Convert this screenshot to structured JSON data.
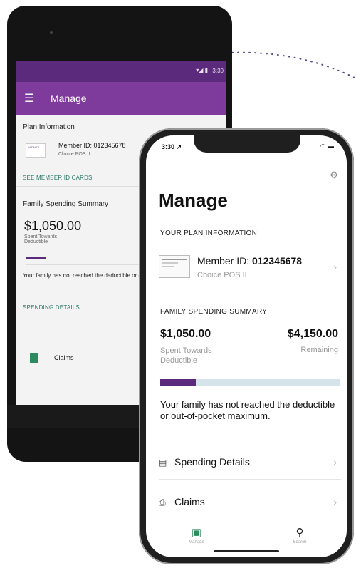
{
  "android": {
    "status_time": "3:30",
    "status_signal": "▾◢ ▮",
    "menu_icon": "hamburger-icon",
    "title": "Manage",
    "plan_section_title": "Plan Information",
    "card_brand": "WIDNEY",
    "member_id": "Member ID: 012345678",
    "plan_name": "Choice POS II",
    "see_cards_link": "SEE MEMBER ID CARDS",
    "spending_section_title": "Family Spending Summary",
    "spent_amount": "$1,050.00",
    "spent_label": "Spent Towards Deductible",
    "progress_fraction": 0.18,
    "family_note": "Your family has not reached the deductible or out-of-pocket maximum.",
    "spending_details_link": "SPENDING DETAILS",
    "claims_label": "Claims",
    "claims_icon": "document-icon"
  },
  "iphone": {
    "status_time": "3:30 ↗",
    "status_icons": "◠ ▬",
    "title": "Manage",
    "plan_section_title": "YOUR PLAN INFORMATION",
    "member_id_label": "Member ID: ",
    "member_id_value": "012345678",
    "plan_name": "Choice POS II",
    "spending_section_title": "FAMILY SPENDING SUMMARY",
    "spent_amount": "$1,050.00",
    "spent_label": "Spent Towards Deductible",
    "remaining_amount": "$4,150.00",
    "remaining_label": "Remaining",
    "progress_fraction": 0.2,
    "family_note": "Your family has not reached the deductible or out-of-pocket maximum.",
    "spending_details_label": "Spending Details",
    "claims_label": "Claims",
    "tabs": [
      {
        "label": "Manage",
        "icon": "id-card-icon"
      },
      {
        "label": "Search",
        "icon": "search-icon"
      }
    ]
  },
  "colors": {
    "purple_dark": "#5b2a7c",
    "purple_appbar": "#7e3b9b",
    "teal_link": "#2d7a6a",
    "bar_track": "#d5e3ea"
  }
}
